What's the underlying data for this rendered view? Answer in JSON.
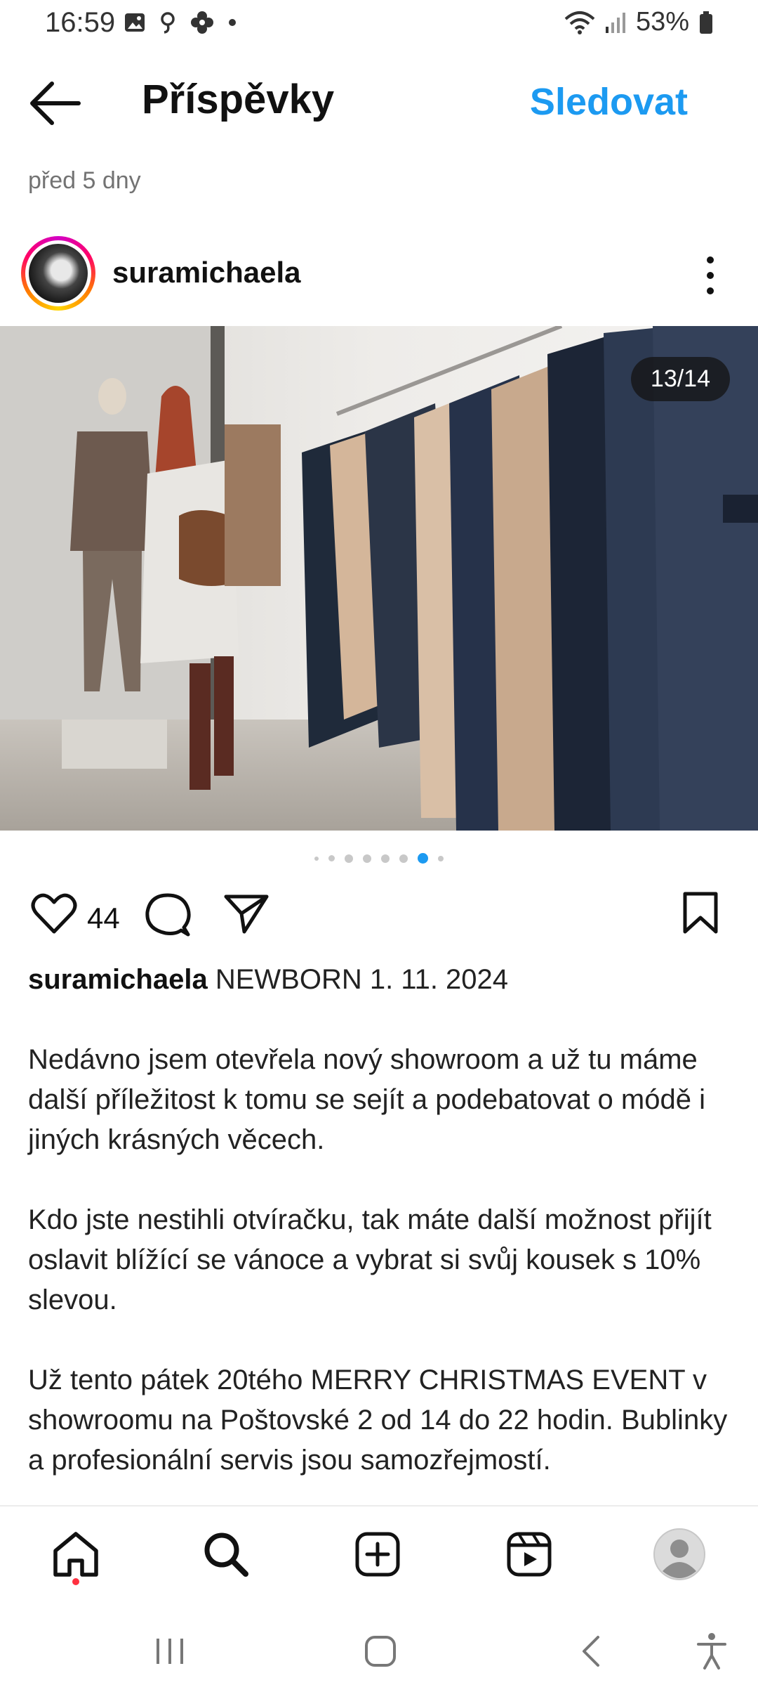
{
  "status_bar": {
    "time": "16:59",
    "battery": "53%"
  },
  "header": {
    "title": "Příspěvky",
    "follow_label": "Sledovat"
  },
  "post": {
    "time_ago": "před 5 dny",
    "username": "suramichaela",
    "image_counter": "13/14",
    "carousel": {
      "dot_count": 8,
      "active_dot": 6
    },
    "likes": "44",
    "caption": {
      "username": "suramichaela",
      "first_line": "NEWBORN 1. 11. 2024",
      "paragraph_1": "Nedávno jsem otevřela nový showroom a už tu máme další příležitost k tomu se sejít a podebatovat o módě i jiných krásných věcech.",
      "paragraph_2": "Kdo jste nestihli otvíračku, tak máte další možnost přijít oslavit blížící se vánoce a vybrat si svůj kousek s 10% slevou.",
      "paragraph_3": "Už tento pátek 20tého MERRY CHRISTMAS EVENT v showroomu na Poštovské 2 od 14 do 22 hodin. Bublinky a profesionální servis jsou samozřejmostí."
    }
  },
  "colors": {
    "accent": "#1c9af1",
    "notification": "#ff3040",
    "active_dot": "#1c9af1"
  },
  "bottom_nav": {
    "items": [
      "home-icon",
      "search-icon",
      "create-icon",
      "reels-icon",
      "profile-icon"
    ]
  },
  "system_nav": {
    "items": [
      "recent-apps-icon",
      "home-button-icon",
      "back-icon",
      "accessibility-icon"
    ]
  }
}
